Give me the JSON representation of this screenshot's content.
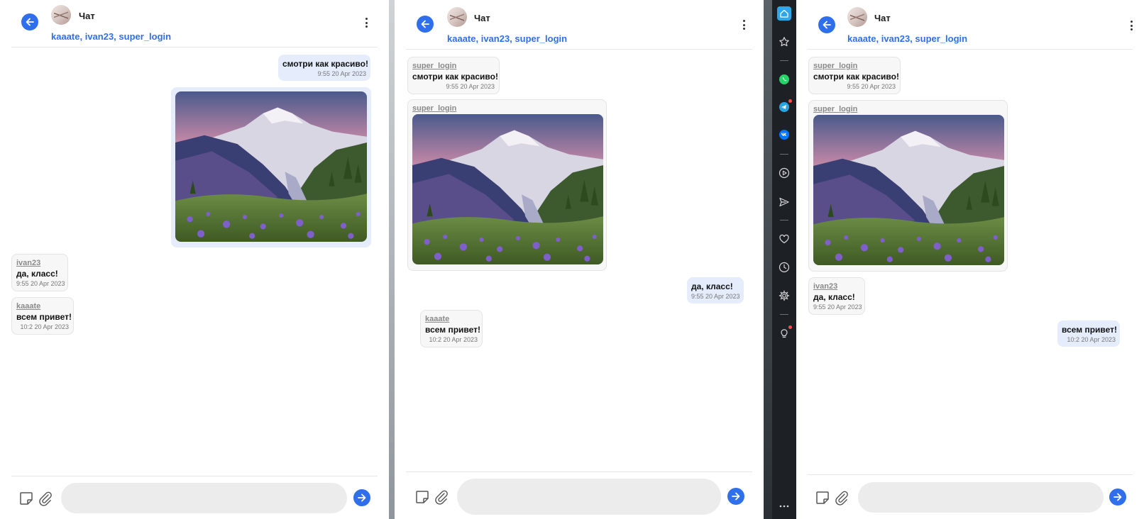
{
  "chat": {
    "title": "Чат",
    "participants": "kaaate, ivan23, super_login",
    "input_placeholder": ""
  },
  "colors": {
    "accent": "#2f6fec",
    "outgoing_bubble": "#e5edfd",
    "incoming_bubble": "#f7f7f7",
    "dock_bg": "#1d2126"
  },
  "panes": [
    {
      "messages": [
        {
          "direction": "out",
          "text": "смотри как красиво!",
          "time": "9:55 20 Apr 2023"
        },
        {
          "direction": "out",
          "type": "image",
          "image": "mountain-wildflower-photo"
        },
        {
          "direction": "in",
          "author": "ivan23",
          "text": "да, класс!",
          "time": "9:55 20 Apr 2023"
        },
        {
          "direction": "in",
          "author": "kaaate",
          "text": "всем привет!",
          "time": "10:2 20 Apr 2023"
        }
      ]
    },
    {
      "messages": [
        {
          "direction": "in",
          "author": "super_login",
          "text": "смотри как красиво!",
          "time": "9:55 20 Apr 2023"
        },
        {
          "direction": "in",
          "author": "super_login",
          "type": "image",
          "image": "mountain-wildflower-photo"
        },
        {
          "direction": "out",
          "text": "да, класс!",
          "time": "9:55 20 Apr 2023"
        },
        {
          "direction": "in",
          "author": "kaaate",
          "text": "всем привет!",
          "time": "10:2 20 Apr 2023"
        }
      ]
    },
    {
      "messages": [
        {
          "direction": "in",
          "author": "super_login",
          "text": "смотри как красиво!",
          "time": "9:55 20 Apr 2023"
        },
        {
          "direction": "in",
          "author": "super_login",
          "type": "image",
          "image": "mountain-wildflower-photo"
        },
        {
          "direction": "in",
          "author": "ivan23",
          "text": "да, класс!",
          "time": "9:55 20 Apr 2023"
        },
        {
          "direction": "out",
          "text": "всем привет!",
          "time": "10:2 20 Apr 2023"
        }
      ]
    }
  ],
  "dock": {
    "items": [
      "home-icon",
      "star-icon",
      "whatsapp-icon",
      "telegram-icon",
      "vk-icon",
      "play-icon",
      "send-icon",
      "heart-icon",
      "clock-icon",
      "gear-icon",
      "lightbulb-icon",
      "more-icon"
    ]
  }
}
